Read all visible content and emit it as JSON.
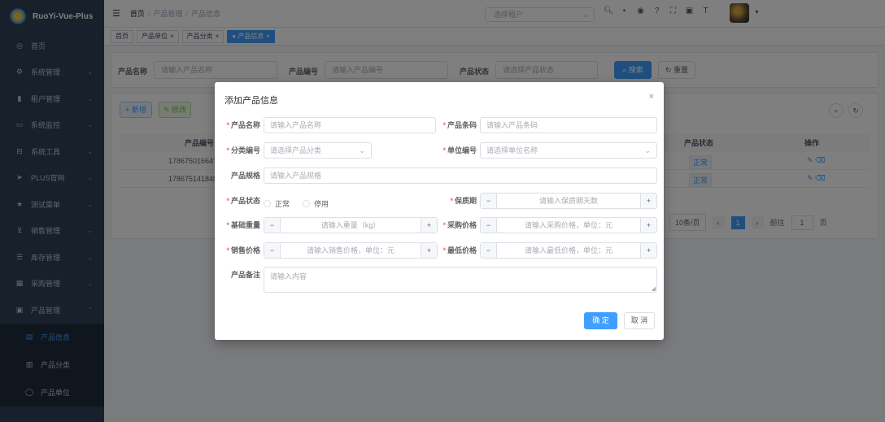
{
  "app": {
    "name": "RuoYi-Vue-Plus"
  },
  "sidebar": {
    "items": [
      {
        "label": "首页",
        "icon": "dashboard-icon",
        "glyph": "◎"
      },
      {
        "label": "系统管理",
        "icon": "gear-icon",
        "glyph": "⚙"
      },
      {
        "label": "租户管理",
        "icon": "chart-icon",
        "glyph": "▮"
      },
      {
        "label": "系统监控",
        "icon": "monitor-icon",
        "glyph": "▭"
      },
      {
        "label": "系统工具",
        "icon": "tool-icon",
        "glyph": "⊟"
      },
      {
        "label": "PLUS官网",
        "icon": "send-icon",
        "glyph": "➤"
      },
      {
        "label": "测试菜单",
        "icon": "star-icon",
        "glyph": "★"
      },
      {
        "label": "销售管理",
        "icon": "cart-icon",
        "glyph": "⊻"
      },
      {
        "label": "库存管理",
        "icon": "list-icon",
        "glyph": "☰"
      },
      {
        "label": "采购管理",
        "icon": "grid-icon",
        "glyph": "▦"
      },
      {
        "label": "产品管理",
        "icon": "box-icon",
        "glyph": "▣"
      }
    ],
    "submenu": [
      {
        "label": "产品信息",
        "icon": "doc-icon",
        "glyph": "▤",
        "active": true
      },
      {
        "label": "产品分类",
        "icon": "category-icon",
        "glyph": "▥"
      },
      {
        "label": "产品单位",
        "icon": "unit-icon",
        "glyph": "◯"
      }
    ]
  },
  "breadcrumb": {
    "home": "首页",
    "sep": "/",
    "level1": "产品管理",
    "level2": "产品信息"
  },
  "header": {
    "tenant_placeholder": "选择租户"
  },
  "tags": [
    {
      "label": "首页",
      "closable": false
    },
    {
      "label": "产品单位",
      "closable": true
    },
    {
      "label": "产品分类",
      "closable": true
    },
    {
      "label": "产品信息",
      "closable": true,
      "active": true
    }
  ],
  "search": {
    "name_label": "产品名称",
    "name_placeholder": "请输入产品名称",
    "code_label": "产品编号",
    "code_placeholder": "请输入产品编号",
    "status_label": "产品状态",
    "status_placeholder": "请选择产品状态",
    "search_btn": "搜索",
    "reset_btn": "重置"
  },
  "toolbar": {
    "add_btn": "新增",
    "edit_btn": "修改"
  },
  "table": {
    "headers": {
      "code": "产品编号",
      "status": "产品状态",
      "actions": "操作"
    },
    "rows": [
      {
        "code": "17867501664794",
        "status": "正常"
      },
      {
        "code": "17867514184030",
        "status": "正常"
      }
    ]
  },
  "pagination": {
    "page_size": "10条/页",
    "current": "1",
    "goto_label": "前往",
    "goto_value": "1",
    "page_suffix": "页"
  },
  "dialog": {
    "title": "添加产品信息",
    "fields": {
      "name": {
        "label": "产品名称",
        "placeholder": "请输入产品名称"
      },
      "barcode": {
        "label": "产品条码",
        "placeholder": "请输入产品条码"
      },
      "category": {
        "label": "分类编号",
        "placeholder": "请选择产品分类"
      },
      "unit": {
        "label": "单位编号",
        "placeholder": "请选择单位名称"
      },
      "spec": {
        "label": "产品规格",
        "placeholder": "请输入产品规格"
      },
      "status": {
        "label": "产品状态",
        "option_normal": "正常",
        "option_disabled": "停用"
      },
      "shelf_life": {
        "label": "保质期",
        "placeholder": "请输入保质期天数"
      },
      "weight": {
        "label": "基础重量",
        "placeholder": "请输入重量（kg）"
      },
      "purchase_price": {
        "label": "采购价格",
        "placeholder": "请输入采购价格，单位：元"
      },
      "sale_price": {
        "label": "销售价格",
        "placeholder": "请输入销售价格，单位：元"
      },
      "min_price": {
        "label": "最低价格",
        "placeholder": "请输入最低价格，单位：元"
      },
      "remark": {
        "label": "产品备注",
        "placeholder": "请输入内容"
      }
    },
    "confirm_btn": "确 定",
    "cancel_btn": "取 消"
  },
  "colors": {
    "primary": "#409eff",
    "sidebar": "#304156",
    "required": "#f56c6c"
  }
}
